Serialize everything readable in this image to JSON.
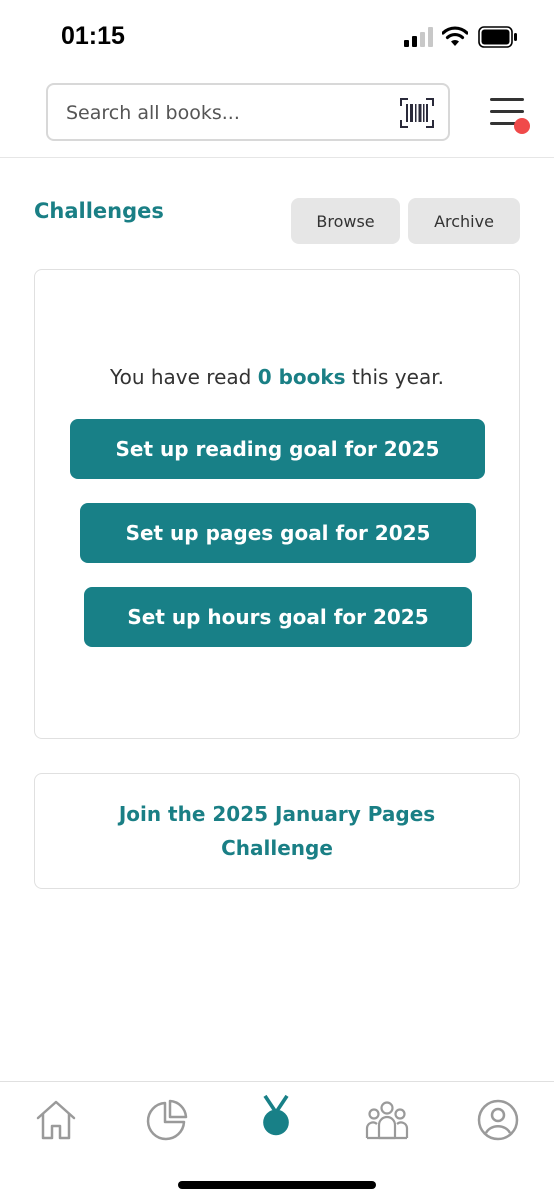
{
  "status_bar": {
    "time": "01:15",
    "icons": [
      "signal-icon",
      "wifi-icon",
      "battery-icon"
    ]
  },
  "header": {
    "search_placeholder": "Search all books...",
    "barcode_icon": "barcode-scan-icon",
    "menu_icon": "hamburger-menu-icon",
    "menu_badge_color": "#f04a4a"
  },
  "challenges": {
    "title": "Challenges",
    "browse_label": "Browse",
    "archive_label": "Archive"
  },
  "goal_card": {
    "read_prefix": "You have read",
    "read_count": "0 books",
    "read_suffix": "this year.",
    "reading_goal_label": "Set up reading goal for 2025",
    "pages_goal_label": "Set up pages goal for 2025",
    "hours_goal_label": "Set up hours goal for 2025"
  },
  "join_card": {
    "label": "Join the 2025 January Pages Challenge"
  },
  "bottom_nav": {
    "items": [
      "home-icon",
      "stats-pie-icon",
      "medal-icon",
      "community-icon",
      "profile-icon"
    ],
    "active": "medal-icon"
  },
  "colors": {
    "accent": "#188087",
    "accent_text": "#1a7f85",
    "pill_bg": "#e6e6e6",
    "nav_inactive": "#9a9a9a"
  }
}
